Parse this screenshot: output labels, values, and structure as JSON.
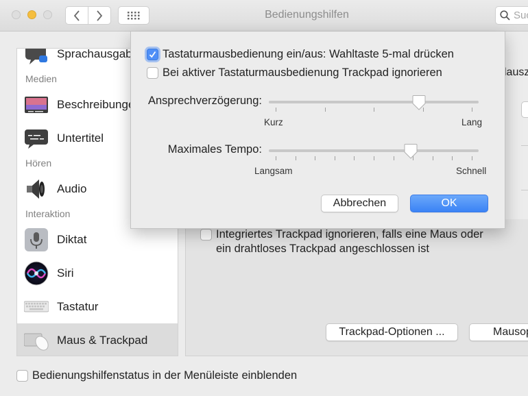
{
  "window": {
    "title": "Bedienungshilfen"
  },
  "toolbar": {
    "search_placeholder": "Suchen"
  },
  "sidebar": {
    "sections": {
      "medien": "Medien",
      "hoeren": "Hören",
      "interaktion": "Interaktion"
    },
    "items": [
      {
        "label": "Sprachausgabe",
        "icon": "speech-bubble-icon"
      },
      {
        "label": "Beschreibungen",
        "icon": "screen-description-icon"
      },
      {
        "label": "Untertitel",
        "icon": "caption-bubble-icon"
      },
      {
        "label": "Audio",
        "icon": "speaker-icon"
      },
      {
        "label": "Diktat",
        "icon": "microphone-icon"
      },
      {
        "label": "Siri",
        "icon": "siri-icon"
      },
      {
        "label": "Tastatur",
        "icon": "keyboard-icon"
      },
      {
        "label": "Maus & Trackpad",
        "icon": "trackpad-mouse-icon",
        "selected": true
      }
    ]
  },
  "main": {
    "fragment_right": "lausz",
    "trackpad_checkbox_line1": "Integriertes Trackpad ignorieren, falls eine Maus oder",
    "trackpad_checkbox_line2": "ein drahtloses Trackpad angeschlossen ist",
    "trackpad_options_button": "Trackpad-Optionen ...",
    "mouse_options_button": "Mausop"
  },
  "sheet": {
    "option1": {
      "label": "Tastaturmausbedienung ein/aus: Wahltaste 5-mal drücken",
      "checked": true
    },
    "option2": {
      "label": "Bei aktiver Tastaturmausbedienung Trackpad ignorieren",
      "checked": false
    },
    "delay_slider": {
      "label": "Ansprechverzögerung:",
      "min_label": "Kurz",
      "max_label": "Lang",
      "value_fraction": 0.73,
      "ticks": 5
    },
    "speed_slider": {
      "label": "Maximales Tempo:",
      "min_label": "Langsam",
      "max_label": "Schnell",
      "value_fraction": 0.69,
      "ticks": 11
    },
    "cancel_button": "Abbrechen",
    "ok_button": "OK"
  },
  "footer": {
    "status_checkbox_label": "Bedienungshilfenstatus in der Menüleiste einblenden",
    "checked": false
  },
  "colors": {
    "accent": "#3b83f5",
    "selection": "#dcdcdc"
  }
}
